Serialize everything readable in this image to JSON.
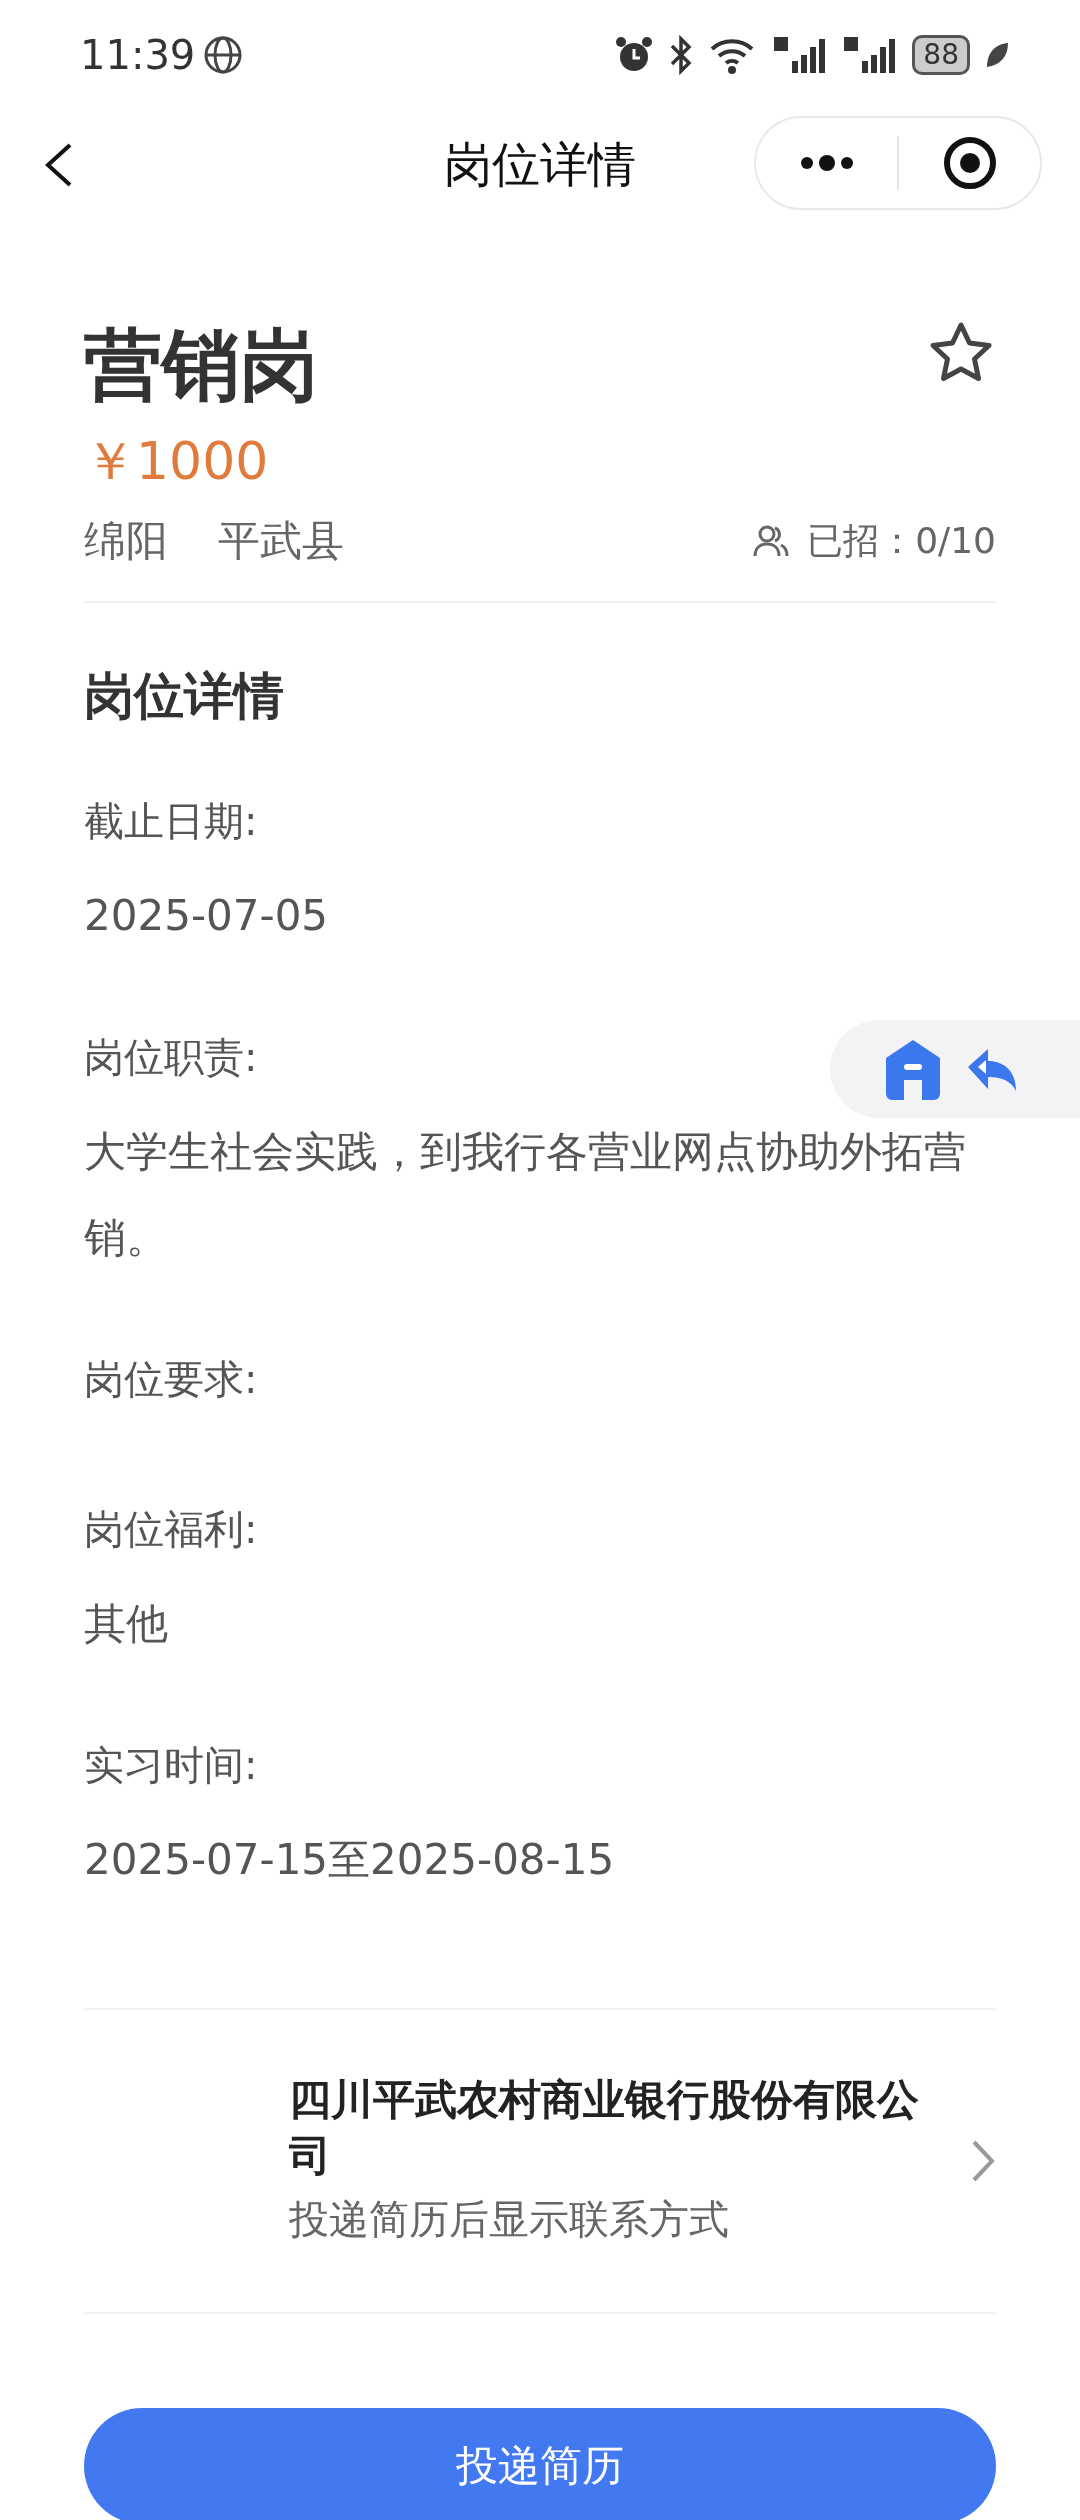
{
  "status_bar": {
    "time": "11:39",
    "battery": "88"
  },
  "nav": {
    "title": "岗位详情"
  },
  "job": {
    "title": "营销岗",
    "favorited": false,
    "salary": "￥1000",
    "city": "绵阳",
    "district": "平武县",
    "recruited": "已招：0/10"
  },
  "section_title": "岗位详情",
  "fields": [
    {
      "label": "截止日期:",
      "value": "2025-07-05"
    },
    {
      "label": "岗位职责:",
      "value": "大学生社会实践，到我行各营业网点协助外拓营销。"
    },
    {
      "label": "岗位要求:"
    },
    {
      "label": "岗位福利:",
      "value": "其他"
    },
    {
      "label": "实习时间:",
      "value": "2025-07-15至2025-08-15"
    }
  ],
  "company": {
    "name": "四川平武农村商业银行股份有限公司",
    "note": "投递简历后显示联系方式"
  },
  "apply_button": "投递简历"
}
